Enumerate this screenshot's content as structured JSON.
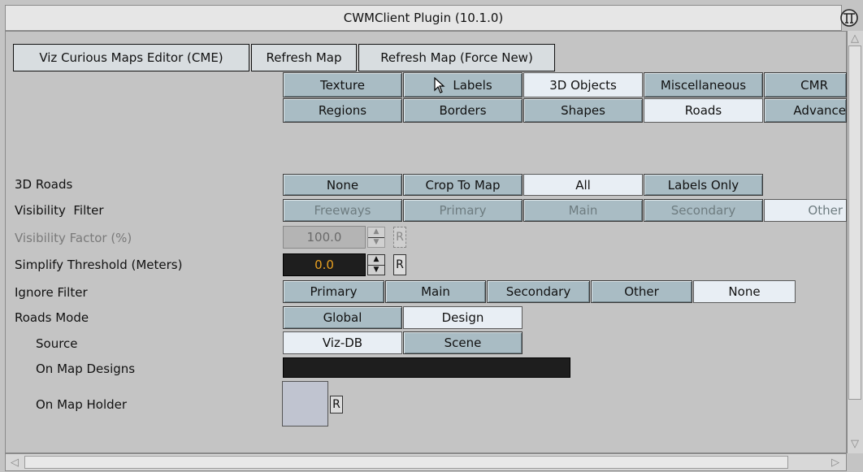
{
  "window": {
    "title": "CWMClient Plugin (10.1.0)"
  },
  "toolbar": {
    "cme_label": "Viz Curious Maps Editor (CME)",
    "refresh_label": "Refresh Map",
    "refresh_force_label": "Refresh Map (Force New)"
  },
  "tabs_row1": [
    "Texture",
    "Labels",
    "3D Objects",
    "Miscellaneous",
    "CMR"
  ],
  "tabs_row2": [
    "Regions",
    "Borders",
    "Shapes",
    "Roads",
    "Advance"
  ],
  "selected_tab": "Roads",
  "roads3d": {
    "label": "3D Roads",
    "options": [
      "None",
      "Crop To Map",
      "All",
      "Labels Only"
    ],
    "selected": "All"
  },
  "visibility_filter": {
    "label": "Visibility  Filter",
    "options": [
      "Freeways",
      "Primary",
      "Main",
      "Secondary",
      "Other"
    ],
    "selected": "Other"
  },
  "visibility_factor": {
    "label": "Visibility Factor (%)",
    "value": "100.0",
    "reset": "R"
  },
  "simplify": {
    "label": "Simplify Threshold (Meters)",
    "value": "0.0",
    "reset": "R"
  },
  "ignore_filter": {
    "label": "Ignore Filter",
    "options": [
      "Primary",
      "Main",
      "Secondary",
      "Other",
      "None"
    ],
    "selected": "None"
  },
  "roads_mode": {
    "label": "Roads Mode",
    "options": [
      "Global",
      "Design"
    ],
    "selected": "Design"
  },
  "source": {
    "label": "Source",
    "options": [
      "Viz-DB",
      "Scene"
    ],
    "selected": "Viz-DB"
  },
  "on_map_designs": {
    "label": "On Map Designs",
    "value": ""
  },
  "on_map_holder": {
    "label": "On Map Holder",
    "reset": "R"
  },
  "colors": {
    "accent_button": "#a9bcc4",
    "selected_button": "#e8eef4",
    "field_dark": "#1e1e1e",
    "field_value": "#e8a020"
  }
}
